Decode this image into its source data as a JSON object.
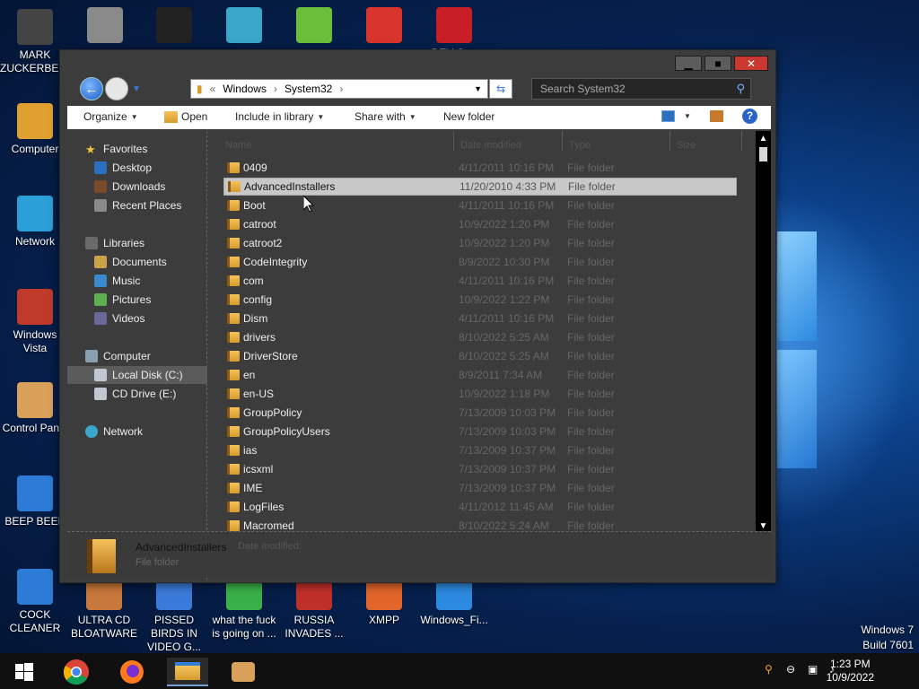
{
  "desktop": {
    "icons_left": [
      {
        "label": "MARK ZUCKERBERG",
        "color": "#444444"
      },
      {
        "label": "Computer",
        "color": "#e0a030"
      },
      {
        "label": "Network",
        "color": "#2a9fd8"
      },
      {
        "label": "Windows Vista",
        "color": "#c03a2b"
      },
      {
        "label": "Control Panel",
        "color": "#d9a05a"
      },
      {
        "label": "BEEP BEEP",
        "color": "#2c7bd6"
      },
      {
        "label": "COCK CLEANER",
        "color": "#2c7bd6"
      }
    ],
    "icons_top": [
      {
        "label": "",
        "color": "#8a8a8a"
      },
      {
        "label": "",
        "color": "#222222"
      },
      {
        "label": "",
        "color": "#3aa6c9"
      },
      {
        "label": "",
        "color": "#6abf3a"
      },
      {
        "label": "",
        "color": "#d9352c"
      },
      {
        "label": "DEV C++",
        "color": "#c81e28"
      }
    ],
    "icons_bottom": [
      {
        "label": "ULTRA CD BLOATWARE",
        "color": "#c8783a"
      },
      {
        "label": "PISSED BIRDS IN VIDEO G...",
        "color": "#3a7ad9"
      },
      {
        "label": "what the fuck is going on ...",
        "color": "#3ab04a"
      },
      {
        "label": "RUSSIA INVADES ...",
        "color": "#c0302b"
      },
      {
        "label": "XMPP",
        "color": "#e2652a"
      },
      {
        "label": "Windows_Fi...",
        "color": "#2c8ae0"
      }
    ]
  },
  "window": {
    "buttons": {
      "minimize": "▁",
      "maximize": "■",
      "close": "✕"
    },
    "address": {
      "prefix": "«",
      "path": [
        "Windows",
        "System32"
      ],
      "separator": "›"
    },
    "search_placeholder": "Search System32",
    "toolbar": {
      "organize": "Organize",
      "open": "Open",
      "include_in_library": "Include in library",
      "share_with": "Share with",
      "new_folder": "New folder",
      "help": "?"
    },
    "nav": {
      "favorites": "Favorites",
      "desktop": "Desktop",
      "downloads": "Downloads",
      "recent_places": "Recent Places",
      "libraries": "Libraries",
      "documents": "Documents",
      "music": "Music",
      "pictures": "Pictures",
      "videos": "Videos",
      "computer": "Computer",
      "local_disk": "Local Disk (C:)",
      "cd_drive": "CD Drive (E:)",
      "network": "Network"
    },
    "columns": {
      "name": "Name",
      "date_modified": "Date modified",
      "type": "Type",
      "size": "Size"
    },
    "files": [
      {
        "name": "0409",
        "date": "4/11/2011 10:16 PM",
        "type": "File folder"
      },
      {
        "name": "AdvancedInstallers",
        "date": "11/20/2010 4:33 PM",
        "type": "File folder"
      },
      {
        "name": "Boot",
        "date": "4/11/2011 10:16 PM",
        "type": "File folder"
      },
      {
        "name": "catroot",
        "date": "10/9/2022 1:20 PM",
        "type": "File folder"
      },
      {
        "name": "catroot2",
        "date": "10/9/2022 1:20 PM",
        "type": "File folder"
      },
      {
        "name": "CodeIntegrity",
        "date": "8/9/2022 10:30 PM",
        "type": "File folder"
      },
      {
        "name": "com",
        "date": "4/11/2011 10:16 PM",
        "type": "File folder"
      },
      {
        "name": "config",
        "date": "10/9/2022 1:22 PM",
        "type": "File folder"
      },
      {
        "name": "Dism",
        "date": "4/11/2011 10:16 PM",
        "type": "File folder"
      },
      {
        "name": "drivers",
        "date": "8/10/2022 5:25 AM",
        "type": "File folder"
      },
      {
        "name": "DriverStore",
        "date": "8/10/2022 5:25 AM",
        "type": "File folder"
      },
      {
        "name": "en",
        "date": "8/9/2011 7:34 AM",
        "type": "File folder"
      },
      {
        "name": "en-US",
        "date": "10/9/2022 1:18 PM",
        "type": "File folder"
      },
      {
        "name": "GroupPolicy",
        "date": "7/13/2009 10:03 PM",
        "type": "File folder"
      },
      {
        "name": "GroupPolicyUsers",
        "date": "7/13/2009 10:03 PM",
        "type": "File folder"
      },
      {
        "name": "ias",
        "date": "7/13/2009 10:37 PM",
        "type": "File folder"
      },
      {
        "name": "icsxml",
        "date": "7/13/2009 10:37 PM",
        "type": "File folder"
      },
      {
        "name": "IME",
        "date": "7/13/2009 10:37 PM",
        "type": "File folder"
      },
      {
        "name": "LogFiles",
        "date": "4/11/2012 11:45 AM",
        "type": "File folder"
      },
      {
        "name": "Macromed",
        "date": "8/10/2022 5:24 AM",
        "type": "File folder"
      }
    ],
    "selected_index": 1,
    "details": {
      "name": "AdvancedInstallers",
      "date_modified_label": "Date modified:",
      "type": "File folder"
    }
  },
  "taskbar": {
    "time": "1:23 PM",
    "date": "10/9/2022",
    "os_name": "Windows 7",
    "build": "Build 7601"
  }
}
